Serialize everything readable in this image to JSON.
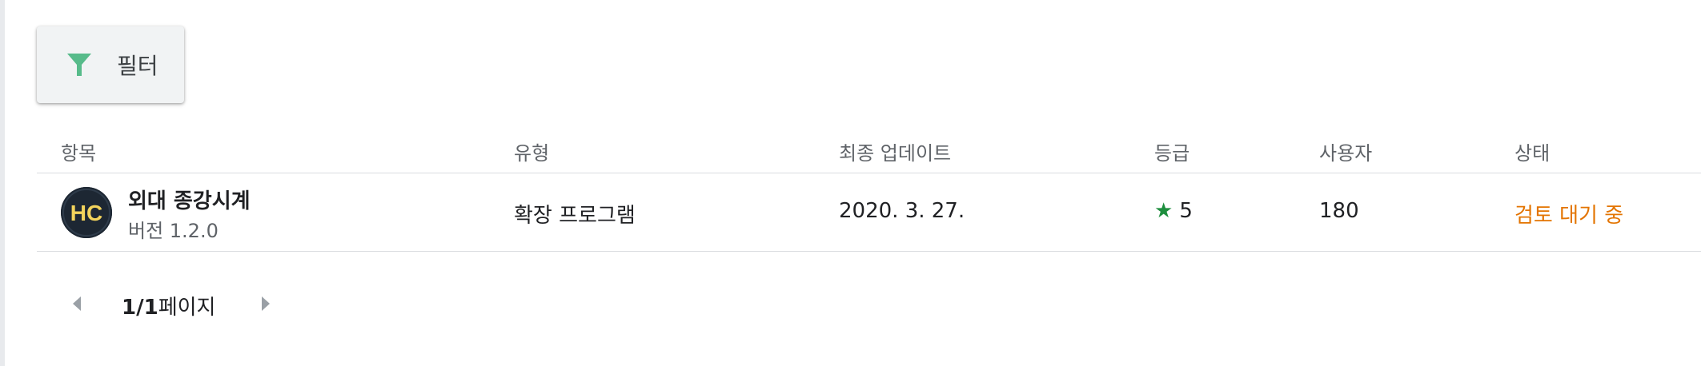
{
  "filter": {
    "label": "필터",
    "icon": "filter-icon",
    "icon_color": "#57bb8a"
  },
  "table": {
    "columns": [
      "항목",
      "유형",
      "최종 업데이트",
      "등급",
      "사용자",
      "상태"
    ],
    "rows": [
      {
        "avatar_text": "HC",
        "name": "외대 종강시계",
        "version": "버전 1.2.0",
        "type": "확장 프로그램",
        "last_updated": "2020. 3. 27.",
        "rating_icon": "star-icon",
        "rating": "5",
        "users": "180",
        "status": "검토 대기 중"
      }
    ]
  },
  "pagination": {
    "current": "1",
    "separator": "/",
    "total": "1",
    "suffix": "페이지",
    "prev_icon": "chevron-left-icon",
    "next_icon": "chevron-right-icon"
  },
  "colors": {
    "status_pending": "#e37400",
    "rating_star": "#1e8e3e",
    "avatar_bg": "#1d2733",
    "avatar_text": "#f2d35c"
  }
}
